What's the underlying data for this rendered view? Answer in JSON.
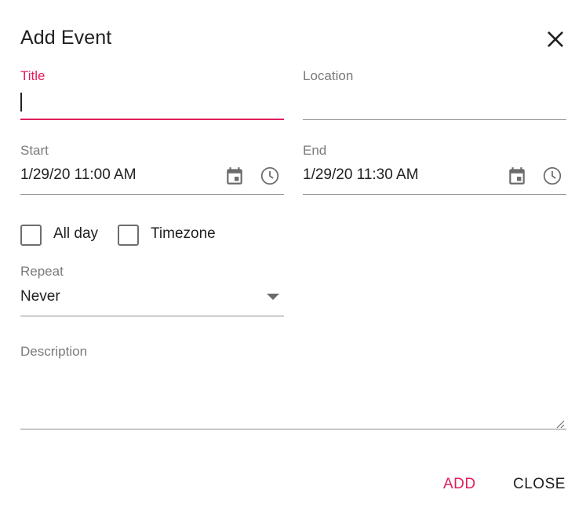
{
  "dialog": {
    "title": "Add Event",
    "close_icon": "close-icon"
  },
  "fields": {
    "title": {
      "label": "Title",
      "value": ""
    },
    "location": {
      "label": "Location",
      "value": ""
    },
    "start": {
      "label": "Start",
      "value": "1/29/20 11:00 AM"
    },
    "end": {
      "label": "End",
      "value": "1/29/20 11:30 AM"
    },
    "repeat": {
      "label": "Repeat",
      "value": "Never"
    },
    "description": {
      "label": "Description",
      "value": ""
    }
  },
  "checkboxes": {
    "all_day": {
      "label": "All day",
      "checked": false
    },
    "timezone": {
      "label": "Timezone",
      "checked": false
    }
  },
  "icons": {
    "calendar": "calendar-icon",
    "clock": "clock-icon",
    "dropdown": "chevron-down-icon",
    "resize": "resize-handle-icon"
  },
  "actions": {
    "add_label": "ADD",
    "close_label": "CLOSE"
  },
  "colors": {
    "accent": "#e01e5a",
    "label": "#7a7a7a",
    "text": "#212121",
    "line": "#8d8d8d"
  }
}
